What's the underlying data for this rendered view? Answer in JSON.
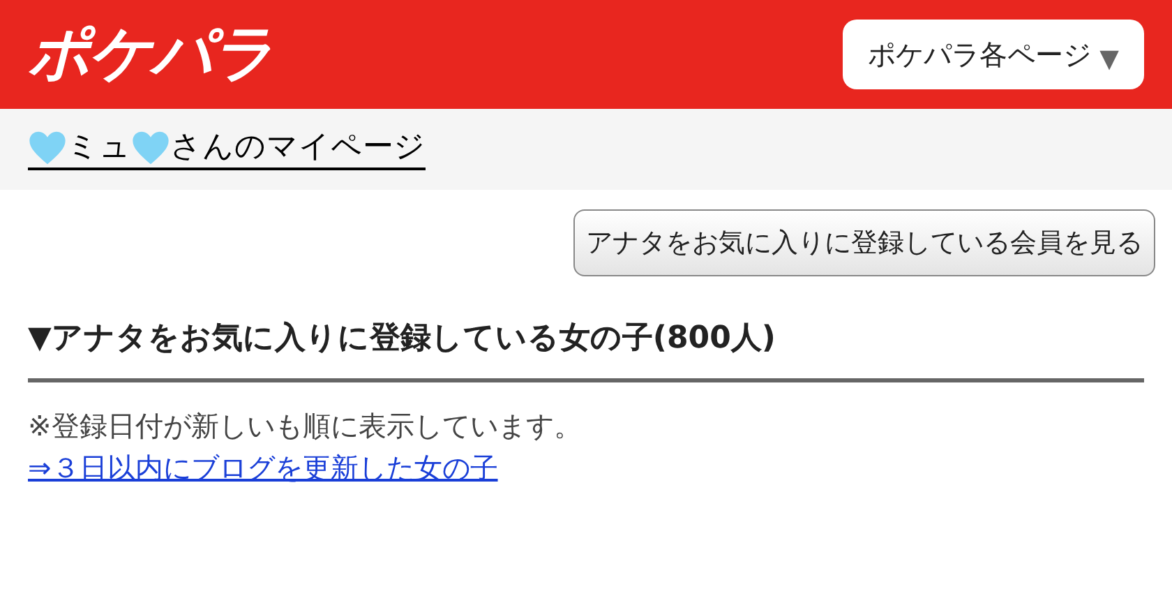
{
  "header": {
    "logo": "ポケパラ",
    "menu": {
      "label": "ポケパラ各ページ",
      "caret": "▼"
    }
  },
  "mypage_link": {
    "name": "ミュ",
    "suffix": "さんのマイページ"
  },
  "favorited_by_button": "アナタをお気に入りに登録している会員を見る",
  "section": {
    "heading": "▼アナタをお気に入りに登録している女の子(800人)",
    "note": "※登録日付が新しいも順に表示しています。",
    "link": "⇒３日以内にブログを更新した女の子"
  }
}
